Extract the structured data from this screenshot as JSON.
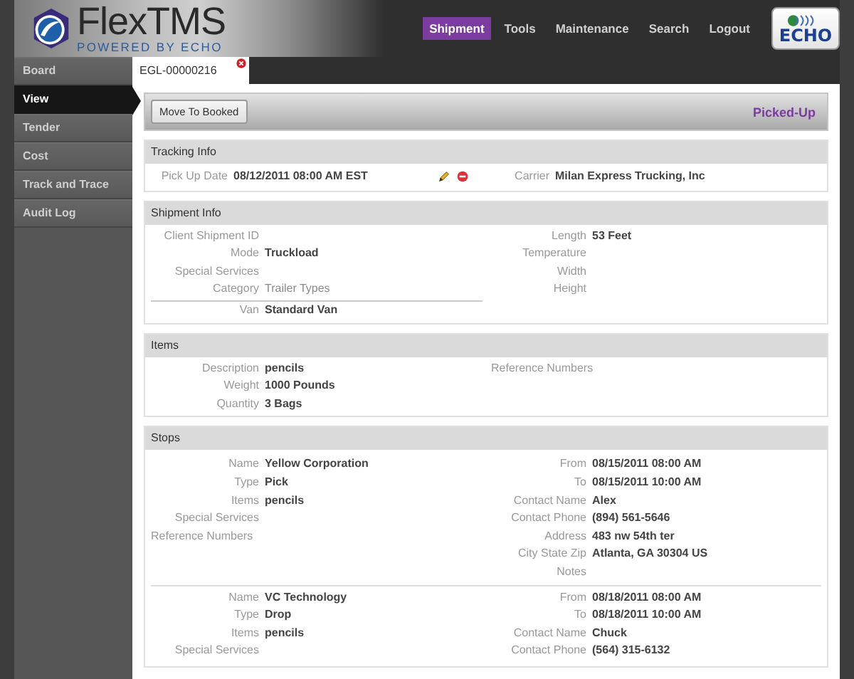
{
  "header": {
    "logo": {
      "name": "FlexTMS",
      "tagline": "POWERED BY ECHO"
    },
    "nav": [
      {
        "label": "Shipment",
        "selected": true
      },
      {
        "label": "Tools",
        "selected": false
      },
      {
        "label": "Maintenance",
        "selected": false
      },
      {
        "label": "Search",
        "selected": false
      },
      {
        "label": "Logout",
        "selected": false
      }
    ],
    "partner_logo": "ECHO"
  },
  "sidebar": {
    "items": [
      {
        "label": "Board",
        "selected": false
      },
      {
        "label": "View",
        "selected": true
      },
      {
        "label": "Tender",
        "selected": false
      },
      {
        "label": "Cost",
        "selected": false
      },
      {
        "label": "Track and Trace",
        "selected": false
      },
      {
        "label": "Audit Log",
        "selected": false
      }
    ]
  },
  "tabs": [
    {
      "label": "EGL-00000216",
      "selected": true
    }
  ],
  "toolbar": {
    "button": "Move To Booked",
    "status": "Picked-Up"
  },
  "sections": [
    {
      "kind": "tracking",
      "title": "Tracking Info",
      "left": [
        {
          "label": "Pick Up Date",
          "value": "08/12/2011 08:00 AM EST"
        }
      ],
      "right": [
        {
          "label": "Carrier",
          "value": "Milan Express Trucking, Inc"
        }
      ]
    },
    {
      "kind": "shipment",
      "title": "Shipment Info",
      "left": [
        {
          "kind": "field",
          "label": "Client Shipment ID"
        },
        {
          "kind": "field",
          "label": "Mode",
          "value": "Truckload"
        },
        {
          "kind": "field",
          "label": "Special Services"
        },
        {
          "kind": "group",
          "label": "Category",
          "value": "Trailer Types"
        },
        {
          "kind": "field",
          "label": "Van",
          "value": "Standard Van"
        }
      ],
      "right": [
        {
          "label": "Length",
          "value": "53 Feet"
        },
        {
          "label": "Temperature"
        },
        {
          "label": "Width"
        },
        {
          "label": "Height"
        }
      ]
    },
    {
      "kind": "items",
      "title": "Items",
      "left": [
        {
          "label": "Description",
          "value": "pencils"
        },
        {
          "label": "Weight",
          "value": "1000 Pounds"
        },
        {
          "label": "Quantity",
          "value": "3 Bags"
        }
      ],
      "right": [
        {
          "kind": "heading",
          "label": "Reference Numbers"
        }
      ]
    },
    {
      "kind": "stops",
      "title": "Stops",
      "stops": [
        {
          "left": [
            {
              "kind": "field",
              "label": "Name",
              "value": "Yellow Corporation"
            },
            {
              "kind": "field",
              "label": "Type",
              "value": "Pick"
            },
            {
              "kind": "field",
              "label": "Items",
              "value": "pencils"
            },
            {
              "kind": "field",
              "label": "Special Services"
            },
            {
              "kind": "heading",
              "label": "Reference Numbers"
            }
          ],
          "right": [
            {
              "label": "From",
              "value": "08/15/2011 08:00 AM"
            },
            {
              "label": "To",
              "value": "08/15/2011 10:00 AM"
            },
            {
              "label": "Contact Name",
              "value": "Alex"
            },
            {
              "label": "Contact Phone",
              "value": "(894) 561-5646"
            },
            {
              "label": "Address",
              "value": "483 nw 54th ter"
            },
            {
              "label": "City State Zip",
              "value": "Atlanta, GA 30304 US"
            },
            {
              "label": "Notes"
            }
          ]
        },
        {
          "left": [
            {
              "kind": "field",
              "label": "Name",
              "value": "VC Technology"
            },
            {
              "kind": "field",
              "label": "Type",
              "value": "Drop"
            },
            {
              "kind": "field",
              "label": "Items",
              "value": "pencils"
            },
            {
              "kind": "field",
              "label": "Special Services"
            }
          ],
          "right": [
            {
              "label": "From",
              "value": "08/18/2011 08:00 AM"
            },
            {
              "label": "To",
              "value": "08/18/2011 10:00 AM"
            },
            {
              "label": "Contact Name",
              "value": "Chuck"
            },
            {
              "label": "Contact Phone",
              "value": "(564) 315-6132"
            }
          ]
        }
      ]
    }
  ]
}
